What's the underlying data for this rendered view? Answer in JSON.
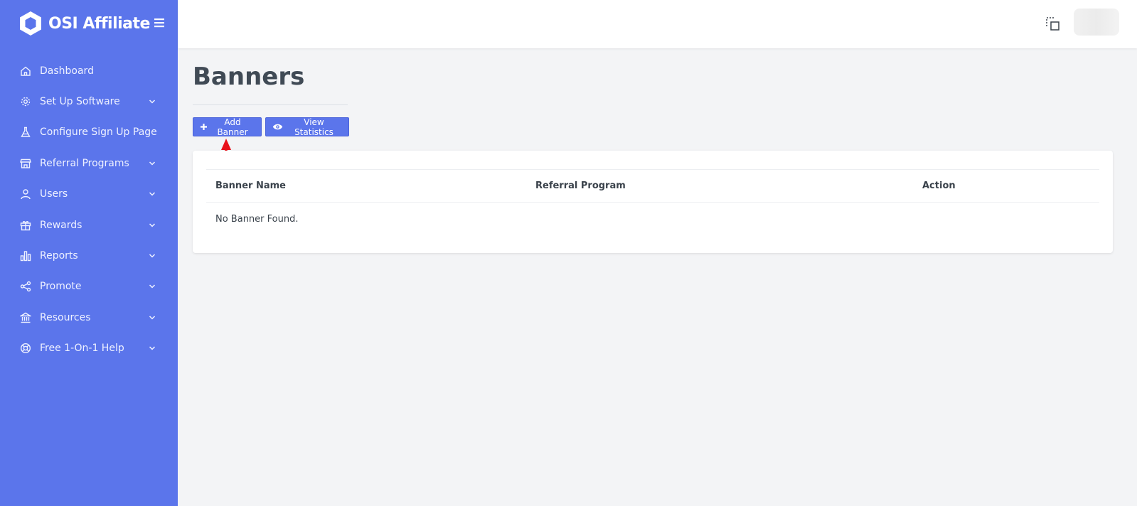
{
  "brand": {
    "name": "OSI Affiliate",
    "color": "#5b75eb"
  },
  "sidebar": {
    "items": [
      {
        "label": "Dashboard",
        "icon": "home-icon",
        "has_submenu": false
      },
      {
        "label": "Set Up Software",
        "icon": "gear-icon",
        "has_submenu": true
      },
      {
        "label": "Configure Sign Up Page",
        "icon": "flask-icon",
        "has_submenu": false
      },
      {
        "label": "Referral Programs",
        "icon": "store-icon",
        "has_submenu": true
      },
      {
        "label": "Users",
        "icon": "user-icon",
        "has_submenu": true
      },
      {
        "label": "Rewards",
        "icon": "gift-icon",
        "has_submenu": true
      },
      {
        "label": "Reports",
        "icon": "bar-chart-icon",
        "has_submenu": true
      },
      {
        "label": "Promote",
        "icon": "share-icon",
        "has_submenu": true
      },
      {
        "label": "Resources",
        "icon": "bank-icon",
        "has_submenu": true
      },
      {
        "label": "Free 1-On-1 Help",
        "icon": "lifebuoy-icon",
        "has_submenu": true
      }
    ]
  },
  "header": {
    "fullscreen_icon": "fullscreen-icon"
  },
  "page": {
    "title": "Banners",
    "buttons": {
      "add_banner": "Add Banner",
      "view_statistics": "View Statistics"
    },
    "table": {
      "columns": [
        "Banner Name",
        "Referral Program",
        "Action"
      ],
      "empty_message": "No Banner Found."
    }
  },
  "annotation": {
    "arrow_color": "#e8101a"
  }
}
